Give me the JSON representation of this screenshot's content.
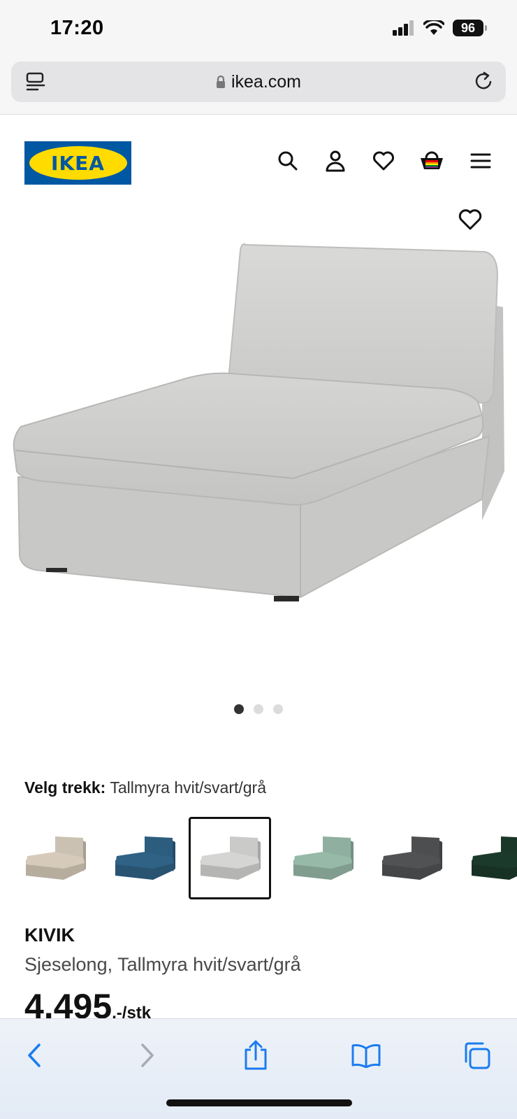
{
  "status_bar": {
    "time": "17:20",
    "battery": "96"
  },
  "browser": {
    "url": "ikea.com"
  },
  "header": {
    "logo_text": "IKEA",
    "icons": [
      "search-icon",
      "user-icon",
      "heart-icon",
      "cart-icon",
      "menu-icon"
    ]
  },
  "gallery": {
    "total_images": 3,
    "current_index": 0
  },
  "cover": {
    "label": "Velg trekk:",
    "value": "Tallmyra hvit/svart/grå",
    "swatches": [
      {
        "color": "#d6cbbb"
      },
      {
        "color": "#2f6285"
      },
      {
        "color": "#d5d5d3"
      },
      {
        "color": "#96b9a8"
      },
      {
        "color": "#505254"
      },
      {
        "color": "#1c3a2b"
      }
    ],
    "selected_index": 2
  },
  "product": {
    "name": "KIVIK",
    "description": "Sjeselong, Tallmyra hvit/svart/grå",
    "price": "4.495",
    "price_suffix": ",-/stk"
  },
  "colors": {
    "ikea_blue": "#0058a3",
    "ikea_yellow": "#ffdb00",
    "ios_blue": "#1a7cf0"
  }
}
